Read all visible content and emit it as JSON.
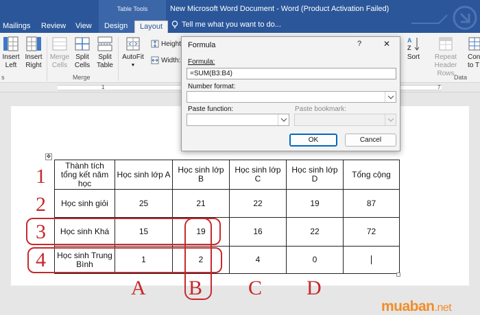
{
  "titlebar": {
    "context_group": "Table Tools",
    "document_title": "New Microsoft Word Document - Word (Product Activation Failed)",
    "accent": "#2b579a"
  },
  "tabs": [
    {
      "label": "Mailings",
      "active": false
    },
    {
      "label": "Review",
      "active": false
    },
    {
      "label": "View",
      "active": false
    },
    {
      "label": "Design",
      "active": false
    },
    {
      "label": "Layout",
      "active": true
    }
  ],
  "tell_me": {
    "placeholder": "Tell me what you want to do...",
    "icon": "lightbulb-icon"
  },
  "ribbon": {
    "insert_left": "Insert\nLeft",
    "insert_right": "Insert\nRight",
    "merge_cells": "Merge\nCells",
    "split_cells": "Split\nCells",
    "split_table": "Split\nTable",
    "autofit": "AutoFit",
    "height_label": "Height:",
    "width_label": "Width:",
    "sort": "Sort",
    "repeat_header_rows": "Repeat\nHeader Rows",
    "convert_to": "Con\nto T",
    "group_merge": "Merge",
    "group_data": "Data",
    "group_rows": "s"
  },
  "ruler": {
    "numbers": [
      "1",
      "7"
    ]
  },
  "dialog": {
    "title": "Formula",
    "help": "?",
    "close": "✕",
    "formula_label": "Formula:",
    "formula_value": "=SUM(B3:B4)",
    "number_format_label": "Number format:",
    "paste_function_label": "Paste function:",
    "paste_bookmark_label": "Paste bookmark:",
    "ok_label": "OK",
    "cancel_label": "Cancel"
  },
  "table": {
    "rows": [
      [
        "Thành tích tổng kết năm học",
        "Học sinh lớp A",
        "Học sinh lớp B",
        "Học sinh lớp C",
        "Học sinh lớp D",
        "Tổng cộng"
      ],
      [
        "Học sinh giỏi",
        "25",
        "21",
        "22",
        "19",
        "87"
      ],
      [
        "Học sinh Khá",
        "15",
        "19",
        "16",
        "22",
        "72"
      ],
      [
        "Học sinh Trung Bình",
        "1",
        "2",
        "4",
        "0",
        ""
      ]
    ]
  },
  "annotations": {
    "row_numbers": [
      "1",
      "2",
      "3",
      "4"
    ],
    "column_letters": [
      "A",
      "B",
      "C",
      "D"
    ],
    "color": "#c6282b"
  },
  "watermark": {
    "brand": "muaban",
    "tld": ".net",
    "color": "#f28c28"
  }
}
